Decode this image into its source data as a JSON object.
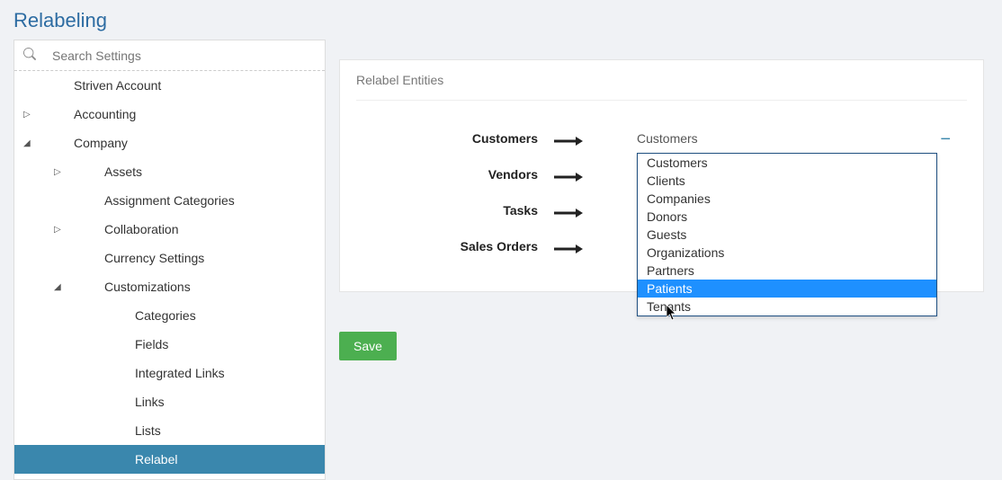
{
  "page_title": "Relabeling",
  "search": {
    "placeholder": "Search Settings"
  },
  "nav": {
    "items": [
      {
        "label": "Striven Account",
        "level": 1,
        "caret": ""
      },
      {
        "label": "Accounting",
        "level": 1,
        "caret": "▷"
      },
      {
        "label": "Company",
        "level": 1,
        "caret": "◢"
      },
      {
        "label": "Assets",
        "level": 2,
        "caret": "▷"
      },
      {
        "label": "Assignment Categories",
        "level": 2,
        "caret": ""
      },
      {
        "label": "Collaboration",
        "level": 2,
        "caret": "▷"
      },
      {
        "label": "Currency Settings",
        "level": 2,
        "caret": ""
      },
      {
        "label": "Customizations",
        "level": 2,
        "caret": "◢"
      },
      {
        "label": "Categories",
        "level": 3,
        "caret": ""
      },
      {
        "label": "Fields",
        "level": 3,
        "caret": ""
      },
      {
        "label": "Integrated Links",
        "level": 3,
        "caret": ""
      },
      {
        "label": "Links",
        "level": 3,
        "caret": ""
      },
      {
        "label": "Lists",
        "level": 3,
        "caret": ""
      },
      {
        "label": "Relabel",
        "level": 3,
        "caret": "",
        "selected": true
      }
    ]
  },
  "panel": {
    "title": "Relabel Entities",
    "rows": [
      {
        "label": "Customers",
        "value": "Customers",
        "open": true
      },
      {
        "label": "Vendors"
      },
      {
        "label": "Tasks"
      },
      {
        "label": "Sales Orders"
      }
    ],
    "dropdown_options": [
      "Customers",
      "Clients",
      "Companies",
      "Donors",
      "Guests",
      "Organizations",
      "Partners",
      "Patients",
      "Tenants"
    ],
    "highlighted_option": "Patients"
  },
  "buttons": {
    "save": "Save"
  }
}
